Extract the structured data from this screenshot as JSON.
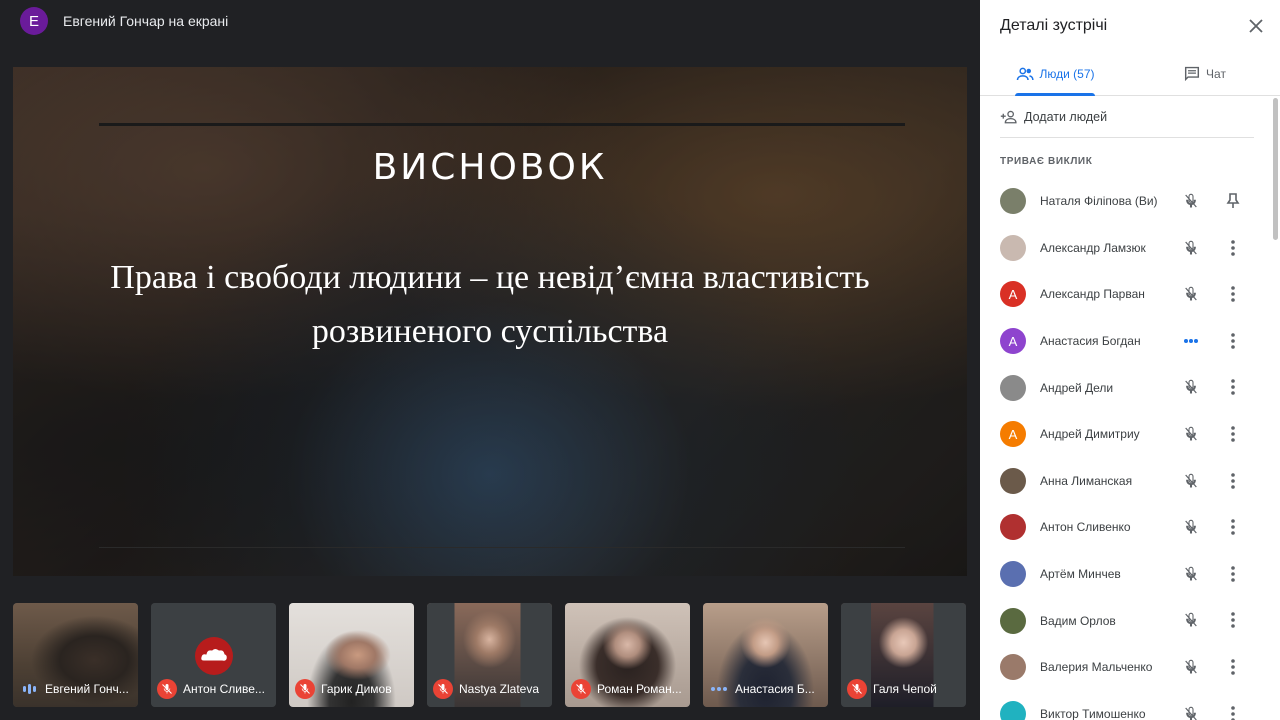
{
  "topbar": {
    "presenter_initial": "E",
    "presenter_label": "Евгений Гончар на екрані",
    "avatar_color": "#6a1b9a"
  },
  "slide": {
    "heading": "ВИСНОВОК",
    "body_line1": "Права і свободи людини – це невід’ємна властивість",
    "body_line2": "розвиненого суспільства"
  },
  "tiles": [
    {
      "name": "Евгений Гонч...",
      "status": "speaking"
    },
    {
      "name": "Антон Сливе...",
      "status": "muted"
    },
    {
      "name": "Гарик Димов",
      "status": "muted"
    },
    {
      "name": "Nastya Zlateva",
      "status": "muted"
    },
    {
      "name": "Роман Роман...",
      "status": "muted"
    },
    {
      "name": "Анастасия Б...",
      "status": "active"
    },
    {
      "name": "Галя Чепой",
      "status": "muted"
    }
  ],
  "panel": {
    "title": "Деталі зустрічі",
    "tab_people": "Люди (57)",
    "tab_chat": "Чат",
    "add_people": "Додати людей",
    "section_title": "ТРИВАЄ ВИКЛИК",
    "accent_color": "#1a73e8"
  },
  "people": [
    {
      "name": "Наталя Філіпова (Ви)",
      "avatar": "photo",
      "color": "#7a7f6a",
      "initial": "",
      "status": "muted",
      "action": "pin"
    },
    {
      "name": "Александр Ламзюк",
      "avatar": "photo",
      "color": "#c9b9b0",
      "initial": "",
      "status": "muted",
      "action": "more"
    },
    {
      "name": "Александр Парван",
      "avatar": "letter",
      "color": "#d93025",
      "initial": "А",
      "status": "muted",
      "action": "more"
    },
    {
      "name": "Анастасия Богдан",
      "avatar": "letter",
      "color": "#8e44ce",
      "initial": "А",
      "status": "active",
      "action": "more"
    },
    {
      "name": "Андрей Дели",
      "avatar": "photo",
      "color": "#8a8a8a",
      "initial": "",
      "status": "muted",
      "action": "more"
    },
    {
      "name": "Андрей Димитриу",
      "avatar": "letter",
      "color": "#f57c00",
      "initial": "А",
      "status": "muted",
      "action": "more"
    },
    {
      "name": "Анна Лиманская",
      "avatar": "photo",
      "color": "#6b5a4a",
      "initial": "",
      "status": "muted",
      "action": "more"
    },
    {
      "name": "Антон Сливенко",
      "avatar": "photo",
      "color": "#b03030",
      "initial": "",
      "status": "muted",
      "action": "more"
    },
    {
      "name": "Артём Минчев",
      "avatar": "photo",
      "color": "#5a6fb0",
      "initial": "",
      "status": "muted",
      "action": "more"
    },
    {
      "name": "Вадим Орлов",
      "avatar": "photo",
      "color": "#5a6a40",
      "initial": "",
      "status": "muted",
      "action": "more"
    },
    {
      "name": "Валерия Мальченко",
      "avatar": "photo",
      "color": "#9a7a6a",
      "initial": "",
      "status": "muted",
      "action": "more"
    },
    {
      "name": "Виктор Тимошенко",
      "avatar": "photo",
      "color": "#20b2c0",
      "initial": "",
      "status": "muted",
      "action": "more"
    }
  ]
}
